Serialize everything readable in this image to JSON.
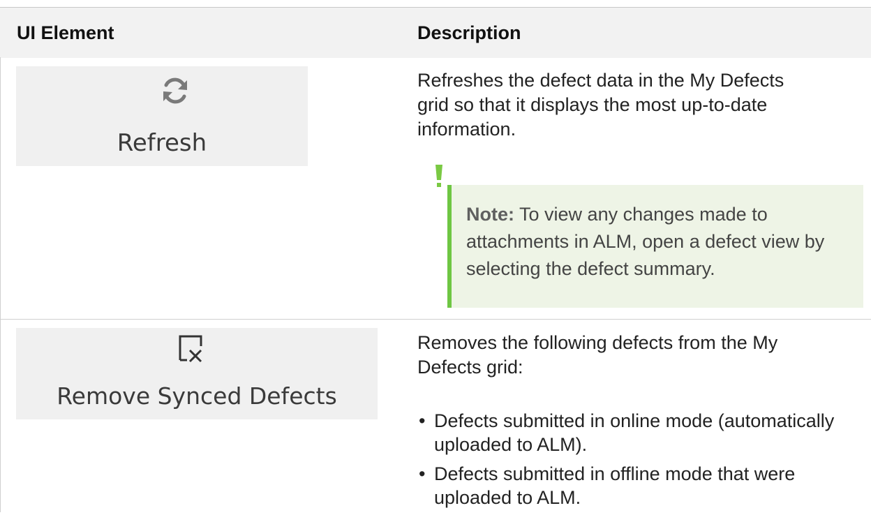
{
  "table": {
    "headers": {
      "ui_element": "UI Element",
      "description": "Description"
    },
    "rows": [
      {
        "ui_label": "Refresh",
        "icon": "refresh-icon",
        "description": "Refreshes the defect data in the My Defects grid so that it displays the most up-to-date information.",
        "note": {
          "label": "Note:",
          "text": "To view any changes made to attachments in ALM, open a defect view by selecting the defect summary."
        }
      },
      {
        "ui_label": "Remove Synced Defects",
        "icon": "remove-synced-icon",
        "description": "Removes the following defects from the My Defects grid:",
        "bullets": [
          "Defects submitted in online mode (automatically uploaded to ALM).",
          "Defects submitted in offline mode that were uploaded to ALM."
        ]
      }
    ]
  },
  "colors": {
    "header_bg": "#f2f2f2",
    "note_bg": "#eef4e6",
    "note_accent": "#6ec643",
    "button_bg": "#f0f0f0"
  }
}
